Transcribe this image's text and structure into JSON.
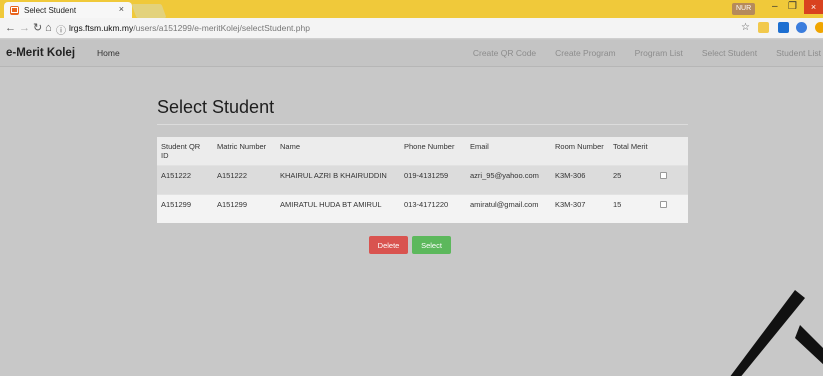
{
  "browser": {
    "tab_title": "Select Student",
    "tab_close": "×",
    "user_chip": "NUR",
    "minimize": "–",
    "maximize": "❐",
    "close": "×",
    "url_host": "lrgs.ftsm.ukm.my",
    "url_path": "/users/a151299/e-meritKolej/selectStudent.php"
  },
  "navbar": {
    "brand": "e-Merit Kolej",
    "home": "Home",
    "links": [
      "Create QR Code",
      "Create Program",
      "Program List",
      "Select Student",
      "Student List"
    ]
  },
  "page": {
    "title": "Select Student"
  },
  "table": {
    "headers": [
      "Student QR ID",
      "Matric Number",
      "Name",
      "Phone Number",
      "Email",
      "Room Number",
      "Total Merit",
      ""
    ],
    "rows": [
      [
        "A151222",
        "A151222",
        "KHAIRUL AZRI B KHAIRUDDIN",
        "019-4131259",
        "azri_95@yahoo.com",
        "K3M-306",
        "25"
      ],
      [
        "A151299",
        "A151299",
        "AMIRATUL HUDA BT AMIRUL",
        "013-4171220",
        "amiratul@gmail.com",
        "K3M-307",
        "15"
      ]
    ]
  },
  "actions": {
    "delete_label": "Delete",
    "select_label": "Select"
  },
  "colors": {
    "tabstrip": "#f0c93a",
    "delete": "#d9534f",
    "select": "#5cb85c"
  }
}
